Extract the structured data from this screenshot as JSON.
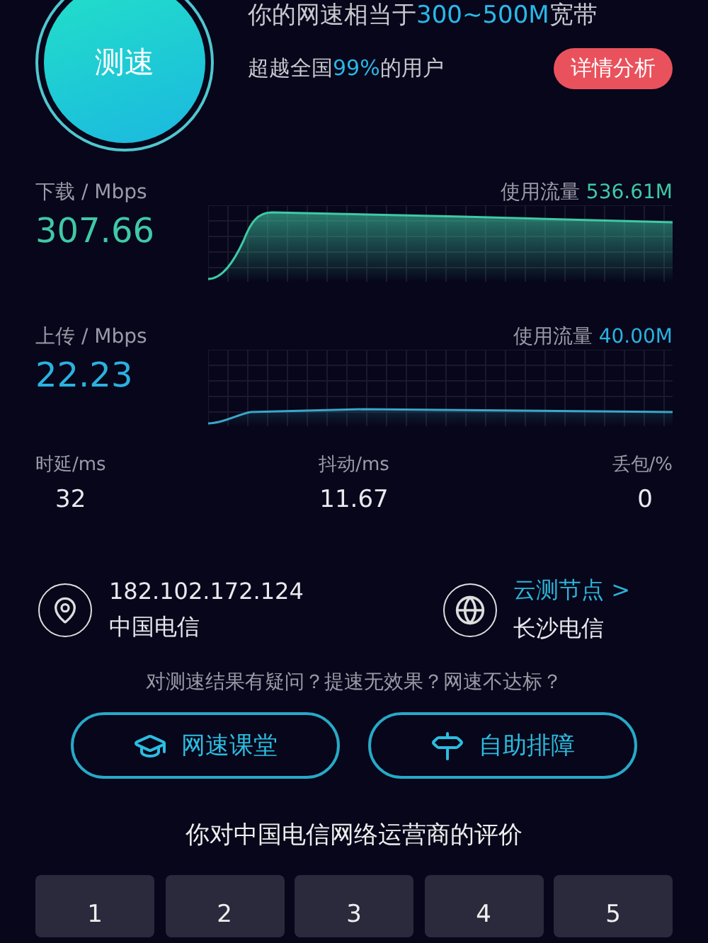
{
  "header": {
    "test_button": "测速",
    "speed_line": {
      "prefix": "你的网速相当于",
      "highlight": "300~500M",
      "suffix": "宽带"
    },
    "rank_line": {
      "prefix": "超越全国",
      "highlight": "99%",
      "suffix": "的用户"
    },
    "detail_button": "详情分析"
  },
  "speeds": [
    {
      "kind": "download",
      "label": "下载 / Mbps",
      "value": "307.66",
      "usage_label": "使用流量",
      "usage": "536.61M"
    },
    {
      "kind": "upload",
      "label": "上传 / Mbps",
      "value": "22.23",
      "usage_label": "使用流量",
      "usage": "40.00M"
    }
  ],
  "metrics": [
    {
      "label": "时延/ms",
      "value": "32"
    },
    {
      "label": "抖动/ms",
      "value": "11.67"
    },
    {
      "label": "丢包/%",
      "value": "0"
    }
  ],
  "connection": {
    "ip": "182.102.172.124",
    "isp": "中国电信",
    "node_link": "云测节点 >",
    "node": "长沙电信"
  },
  "question": "对测速结果有疑问？提速无效果？网速不达标？",
  "actions": [
    {
      "kind": "course",
      "label": "网速课堂"
    },
    {
      "kind": "troubleshoot",
      "label": "自助排障"
    }
  ],
  "rating": {
    "title": "你对中国电信网络运营商的评价",
    "options": [
      "1",
      "2",
      "3",
      "4",
      "5"
    ]
  }
}
